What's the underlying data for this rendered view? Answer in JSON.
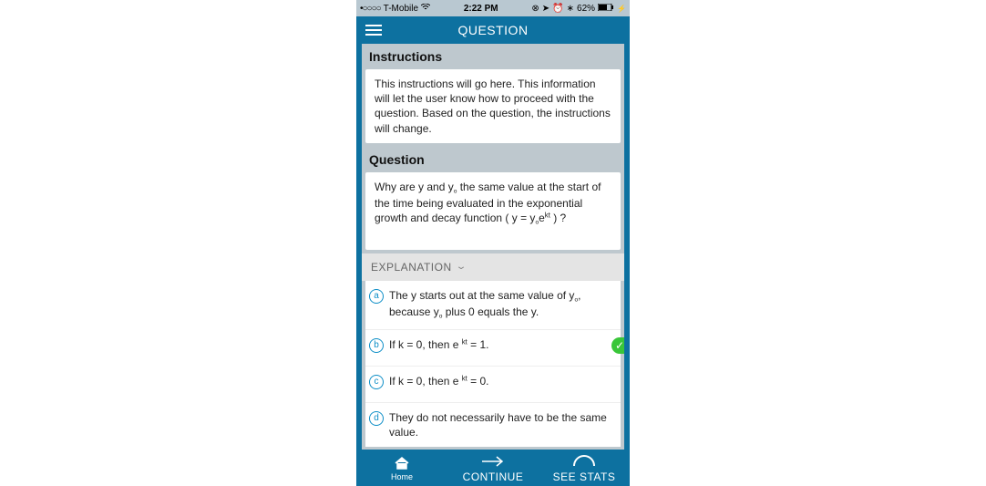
{
  "statusbar": {
    "carrier": "T-Mobile",
    "signal_dots": "•○○○○",
    "wifi": "✶",
    "time": "2:22 PM",
    "icons": "⦿ ➤ ⏰ ✱",
    "battery_pct": "62%"
  },
  "header": {
    "title": "QUESTION"
  },
  "instructions": {
    "heading": "Instructions",
    "body": "This instructions will go here. This information will let the user know how to proceed with the question. Based on the question, the instructions will change."
  },
  "question": {
    "heading": "Question",
    "body_html": "Why are y and y<sub>o</sub> the same value at the start of the time being evaluated in the exponential growth and decay function ( y = y<sub>o</sub>e<sup>kt</sup> ) ?"
  },
  "explanation": {
    "heading": "EXPLANATION"
  },
  "options": [
    {
      "letter": "a",
      "text_html": "The y starts out at the same value of y<sub>o</sub>, because y<sub>o</sub> plus 0 equals the y.",
      "correct": false
    },
    {
      "letter": "b",
      "text_html": "If k = 0, then e <sup>kt</sup> = 1.",
      "correct": true
    },
    {
      "letter": "c",
      "text_html": "If k = 0, then e <sup>kt</sup> = 0.",
      "correct": false
    },
    {
      "letter": "d",
      "text_html": "They do not necessarily have to be the same value.",
      "correct": false
    }
  ],
  "footer": {
    "home": "Home",
    "continue": "CONTINUE",
    "stats": "SEE STATS"
  }
}
